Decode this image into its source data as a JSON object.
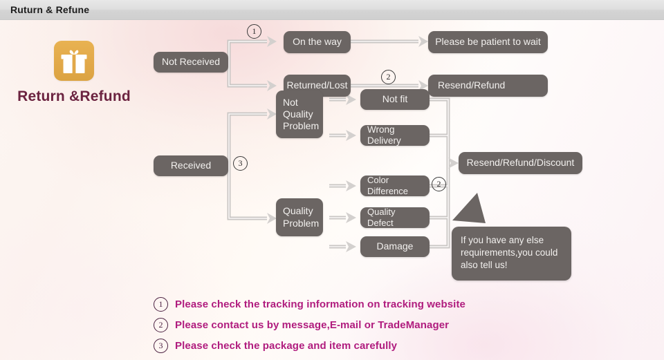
{
  "header": {
    "title": "Ruturn & Refune"
  },
  "brand": {
    "icon": "gift-icon",
    "label": "Return &Refund"
  },
  "colors": {
    "node_fill": "#6b6563",
    "node_text": "#f2f0ee",
    "brand_icon": "#e2a949",
    "brand_text": "#6b2340",
    "legend_text": "#b01c7e",
    "connector": "#c9c6c4",
    "header_bar": "#dfdfdf"
  },
  "flow": {
    "nodes": [
      {
        "id": "not-received",
        "label": "Not Received"
      },
      {
        "id": "on-the-way",
        "label": "On the way"
      },
      {
        "id": "returned-lost",
        "label": "Returned/Lost"
      },
      {
        "id": "please-be-patient",
        "label": "Please be patient to wait"
      },
      {
        "id": "resend-refund",
        "label": "Resend/Refund"
      },
      {
        "id": "received",
        "label": "Received"
      },
      {
        "id": "not-quality-problem",
        "label": "Not\nQuality\nProblem"
      },
      {
        "id": "quality-problem",
        "label": "Quality\nProblem"
      },
      {
        "id": "not-fit",
        "label": "Not fit"
      },
      {
        "id": "wrong-delivery",
        "label": "Wrong Delivery"
      },
      {
        "id": "color-difference",
        "label": "Color Difference"
      },
      {
        "id": "quality-defect",
        "label": "Quality Defect"
      },
      {
        "id": "damage",
        "label": "Damage"
      },
      {
        "id": "resend-refund-discount",
        "label": "Resend/Refund/Discount"
      }
    ],
    "markers": [
      {
        "id": "marker-1-top",
        "label": "1"
      },
      {
        "id": "marker-2-top",
        "label": "2"
      },
      {
        "id": "marker-3-middle",
        "label": "3"
      },
      {
        "id": "marker-2-bottom",
        "label": "2"
      }
    ],
    "bubble": {
      "text": "If you have any else requirements,you could also tell us!"
    }
  },
  "legend": {
    "items": [
      {
        "num": "1",
        "text": "Please check the tracking information on tracking website"
      },
      {
        "num": "2",
        "text": "Please contact us by message,E-mail or TradeManager"
      },
      {
        "num": "3",
        "text": "Please check the package and item carefully"
      }
    ]
  }
}
